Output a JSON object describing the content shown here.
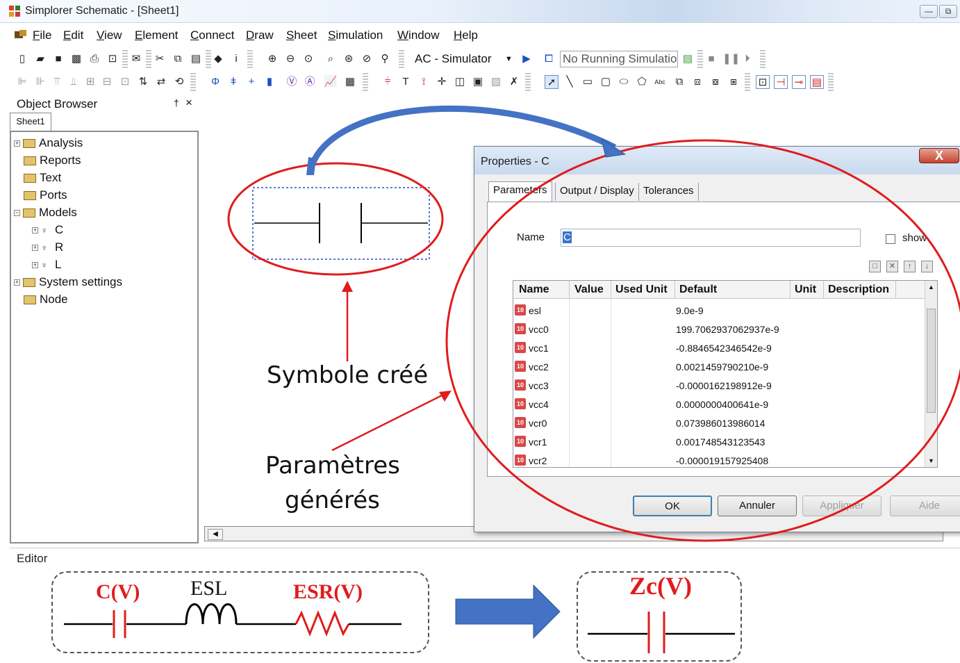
{
  "window": {
    "title": "Simplorer Schematic - [Sheet1]",
    "minimize_glyph": "—",
    "restore_glyph": "⧉"
  },
  "menu": [
    "File",
    "Edit",
    "View",
    "Element",
    "Connect",
    "Draw",
    "Sheet",
    "Simulation",
    "Window",
    "Help"
  ],
  "toolbar": {
    "simulator": "AC - Simulator",
    "status": "No Running Simulatio"
  },
  "object_browser": {
    "title": "Object Browser",
    "pin_glyph": "†",
    "close_glyph": "×",
    "tab": "Sheet1",
    "tree": {
      "analysis": "Analysis",
      "reports": "Reports",
      "text": "Text",
      "ports": "Ports",
      "models": "Models",
      "c": "C",
      "r": "R",
      "l": "L",
      "system_settings": "System settings",
      "node": "Node"
    }
  },
  "editor": {
    "label": "Editor"
  },
  "dialog": {
    "title": "Properties - C",
    "close_glyph": "X",
    "tabs": [
      "Parameters",
      "Output / Display",
      "Tolerances"
    ],
    "name_label": "Name",
    "name_value": "C",
    "show_label": "show",
    "columns": [
      "Name",
      "Value",
      "Used Unit",
      "Default",
      "Unit",
      "Description"
    ],
    "rows": [
      {
        "name": "esl",
        "default": "9.0e-9"
      },
      {
        "name": "vcc0",
        "default": "199.7062937062937e-9"
      },
      {
        "name": "vcc1",
        "default": "-0.8846542346542e-9"
      },
      {
        "name": "vcc2",
        "default": "0.0021459790210e-9"
      },
      {
        "name": "vcc3",
        "default": "-0.0000162198912e-9"
      },
      {
        "name": "vcc4",
        "default": "0.0000000400641e-9"
      },
      {
        "name": "vcr0",
        "default": "0.073986013986014"
      },
      {
        "name": "vcr1",
        "default": "0.001748543123543"
      },
      {
        "name": "vcr2",
        "default": "-0.000019157925408"
      }
    ],
    "buttons": {
      "ok": "OK",
      "cancel": "Annuler",
      "apply": "Appliquer",
      "help": "Aide"
    }
  },
  "annotations": {
    "symbol": "Symbole créé",
    "params_line1": "Paramètres",
    "params_line2": "générés"
  },
  "circuit": {
    "c_label": "C(V)",
    "esl_label": "ESL",
    "esr_label": "ESR(V)",
    "zc_label": "Zc(V)"
  },
  "colors": {
    "annotation_red": "#e01c1c",
    "arrow_blue": "#4472c4"
  }
}
